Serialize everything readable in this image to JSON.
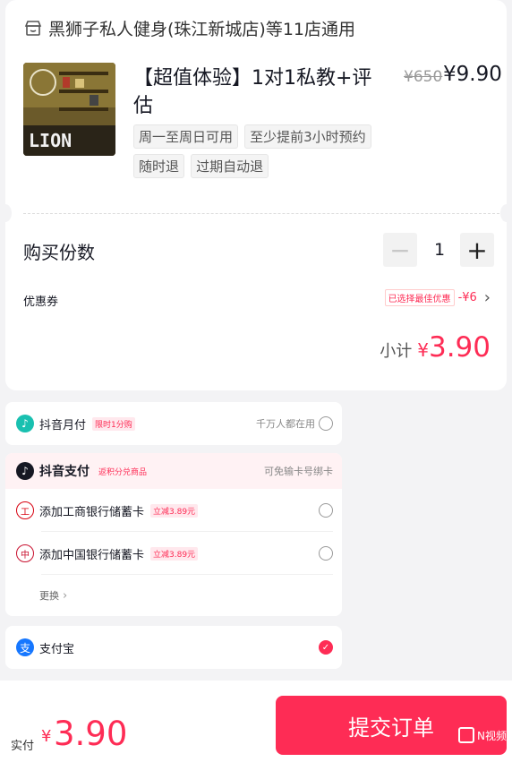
{
  "store": {
    "name": "黑狮子私人健身(珠江新城店)等11店通用"
  },
  "product": {
    "title": "【超值体验】1对1私教+评估",
    "price_original": "¥650",
    "price_current": "¥9.90",
    "image_text": "LION",
    "tags": [
      "周一至周日可用",
      "至少提前3小时预约",
      "随时退",
      "过期自动退"
    ]
  },
  "quantity": {
    "label": "购买份数",
    "value": "1",
    "minus": "−",
    "plus": "+"
  },
  "coupon": {
    "label": "优惠券",
    "badge": "已选择最佳优惠",
    "value": "-¥6",
    "chevron": "›"
  },
  "subtotal": {
    "label": "小计",
    "currency": "¥",
    "amount": "3.90"
  },
  "payment": {
    "douyin_monthly": {
      "name": "抖音月付",
      "badge": "限时1分购",
      "hint": "千万人都在用",
      "icon": "douyin-icon"
    },
    "douyin_pay": {
      "name": "抖音支付",
      "badge": "返积分兑商品",
      "hint": "可免输卡号绑卡",
      "icon": "douyin-icon"
    },
    "icbc": {
      "name": "添加工商银行储蓄卡",
      "badge": "立减3.89元",
      "icon": "icbc-icon"
    },
    "boc": {
      "name": "添加中国银行储蓄卡",
      "badge": "立减3.89元",
      "icon": "boc-icon"
    },
    "more": {
      "label": "更换",
      "chevron": "›"
    },
    "alipay": {
      "name": "支付宝",
      "icon": "alipay-icon",
      "check": "✓"
    }
  },
  "footer": {
    "paid_label": "实付",
    "currency": "¥",
    "amount": "3.90",
    "submit": "提交订单",
    "watermark": "N视频"
  },
  "colors": {
    "accent": "#fe2c55",
    "douyin_monthly": "#19c0b0",
    "alipay": "#1677ff",
    "icbc": "#d7000f",
    "boc": "#c8102e"
  }
}
